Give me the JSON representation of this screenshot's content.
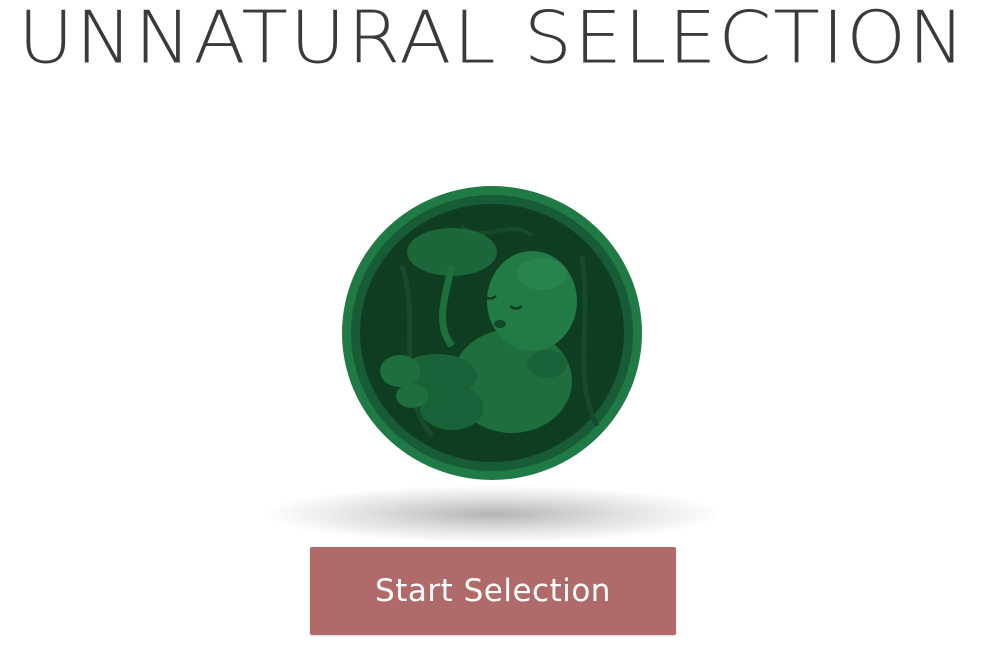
{
  "app": {
    "title": "UNNATURAL SELECTION"
  },
  "hero": {
    "image": "embryo-in-womb-illustration",
    "colors": {
      "outer": "#1f7a45",
      "inner": "#0f3d22",
      "figure": "#1e6e3e"
    }
  },
  "actions": {
    "start_label": "Start Selection",
    "start_color": "#b06a6a"
  }
}
